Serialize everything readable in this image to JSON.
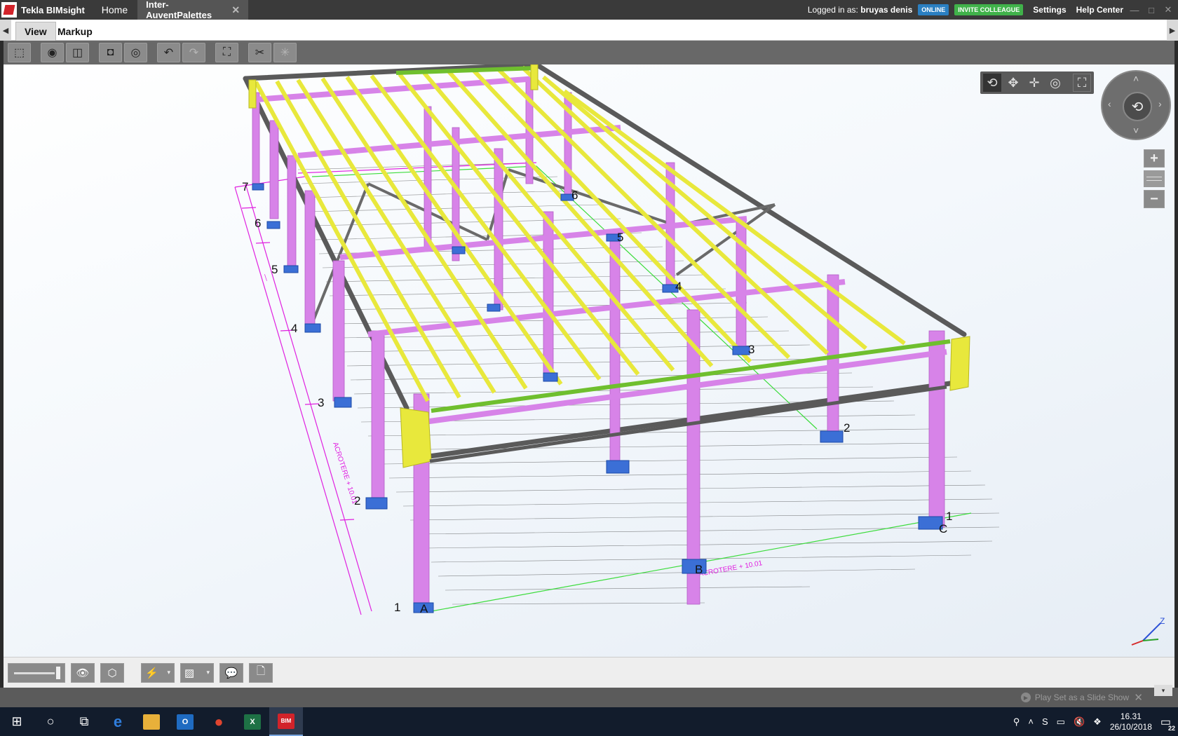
{
  "app": {
    "name": "Tekla BIMsight",
    "tabs": [
      {
        "label": "Home"
      },
      {
        "label": "Inter-AuventPalettes",
        "close": "✕"
      }
    ],
    "logged_prefix": "Logged in as:",
    "user": "bruyas denis",
    "status_badge": "ONLINE",
    "invite_label": "INVITE COLLEAGUE",
    "settings_label": "Settings",
    "help_label": "Help Center",
    "window_controls": [
      "—",
      "□",
      "✕"
    ]
  },
  "ribbon": {
    "tabs": [
      "View",
      "Markup"
    ],
    "active_tab": "View"
  },
  "toolbar": {
    "buttons": [
      {
        "name": "select-area-icon",
        "glyph": "⬚"
      },
      {
        "name": "hide-icon",
        "glyph": "◉"
      },
      {
        "name": "show-selected-icon",
        "glyph": "◫"
      },
      {
        "name": "hide-selected-icon",
        "glyph": "◘"
      },
      {
        "name": "show-all-icon",
        "glyph": "◎"
      },
      {
        "name": "undo-icon",
        "glyph": "↶"
      },
      {
        "name": "redo-icon",
        "glyph": "↷"
      },
      {
        "name": "fit-view-icon",
        "glyph": "⛶"
      },
      {
        "name": "clip-icon",
        "glyph": "✂"
      },
      {
        "name": "clip-remove-icon",
        "glyph": "✳"
      }
    ]
  },
  "viewport": {
    "view_tools": [
      {
        "name": "rotate-icon",
        "glyph": "⟲"
      },
      {
        "name": "pan-icon",
        "glyph": "✥"
      },
      {
        "name": "move-icon",
        "glyph": "✛"
      },
      {
        "name": "look-around-icon",
        "glyph": "◎"
      },
      {
        "name": "fullscreen-icon",
        "glyph": "⛶"
      }
    ],
    "nav_center_glyph": "⟲",
    "zoom_in": "+",
    "zoom_out": "−",
    "grid_labels": {
      "left": [
        "7",
        "6",
        "5",
        "4",
        "3",
        "2",
        "1"
      ],
      "right": [
        "6",
        "5",
        "4",
        "3",
        "2",
        "1"
      ],
      "letters": [
        "A",
        "B",
        "C"
      ]
    },
    "axis_label": "Z"
  },
  "bottom_toolbar": {
    "buttons": [
      {
        "name": "visibility-icon",
        "glyph": "👁"
      },
      {
        "name": "box-icon",
        "glyph": "⬡"
      },
      {
        "name": "flash-icon",
        "glyph": "⚡",
        "dropdown": "▾"
      },
      {
        "name": "render-mode-icon",
        "glyph": "▨",
        "dropdown": "▾"
      },
      {
        "name": "comment-icon",
        "glyph": "💬"
      },
      {
        "name": "document-icon",
        "glyph": "🗋"
      }
    ]
  },
  "status": {
    "slideshow_label": "Play Set as a Slide Show",
    "collapse": "▾"
  },
  "taskbar": {
    "time": "16.31",
    "date": "26/10/2018",
    "notifications": "22",
    "apps": [
      {
        "name": "windows-start-icon",
        "glyph": "⊞"
      },
      {
        "name": "cortana-icon",
        "glyph": "○"
      },
      {
        "name": "task-view-icon",
        "glyph": "⧉"
      },
      {
        "name": "edge-icon",
        "glyph": "e",
        "color": "#2f7ddc"
      },
      {
        "name": "file-explorer-icon",
        "glyph": "▬",
        "color": "#e8b03a"
      },
      {
        "name": "outlook-icon",
        "glyph": "O",
        "color": "#1f6bc1"
      },
      {
        "name": "chrome-icon",
        "glyph": "●",
        "color": "#e0452f"
      },
      {
        "name": "excel-icon",
        "glyph": "X",
        "color": "#1e7145"
      },
      {
        "name": "bimsight-icon",
        "glyph": "BIM",
        "color": "#d2232a"
      }
    ],
    "tray": [
      {
        "name": "people-icon",
        "glyph": "⚲"
      },
      {
        "name": "tray-expand-icon",
        "glyph": "˄"
      },
      {
        "name": "skype-icon",
        "glyph": "S"
      },
      {
        "name": "network-icon",
        "glyph": "▭"
      },
      {
        "name": "volume-icon",
        "glyph": "🔇"
      },
      {
        "name": "dropbox-icon",
        "glyph": "❖"
      }
    ]
  },
  "colors": {
    "column": "#d783e8",
    "purlin": "#e8e83c",
    "edge_beam": "#6fbf2e",
    "bracing": "#666666",
    "footing": "#3b6fd6",
    "grid": "#e020e0"
  }
}
